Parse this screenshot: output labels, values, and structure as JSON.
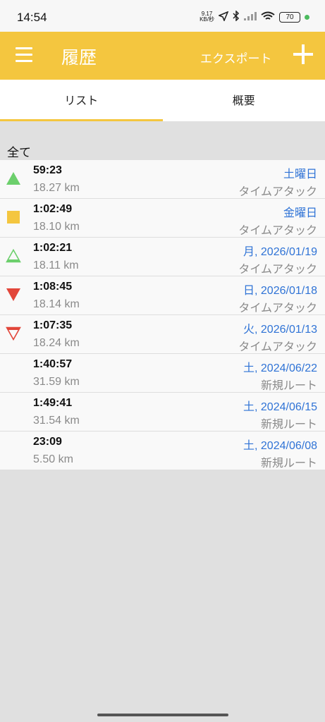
{
  "status_bar": {
    "time": "14:54",
    "speed_value": "9.17",
    "speed_unit": "KB/秒",
    "battery": "70"
  },
  "app_bar": {
    "title": "履歴",
    "export_label": "エクスポート"
  },
  "tabs": [
    {
      "label": "リスト",
      "active": true
    },
    {
      "label": "概要",
      "active": false
    }
  ],
  "section_header": "全て",
  "rows": [
    {
      "icon": "up-triangle-filled-green",
      "time": "59:23",
      "distance": "18.27 km",
      "date": "土曜日",
      "type": "タイムアタック"
    },
    {
      "icon": "square-yellow",
      "time": "1:02:49",
      "distance": "18.10 km",
      "date": "金曜日",
      "type": "タイムアタック"
    },
    {
      "icon": "up-triangle-outline-green",
      "time": "1:02:21",
      "distance": "18.11 km",
      "date": "月, 2026/01/19",
      "type": "タイムアタック"
    },
    {
      "icon": "down-triangle-filled-red",
      "time": "1:08:45",
      "distance": "18.14 km",
      "date": "日, 2026/01/18",
      "type": "タイムアタック"
    },
    {
      "icon": "down-triangle-outline-red",
      "time": "1:07:35",
      "distance": "18.24 km",
      "date": "火, 2026/01/13",
      "type": "タイムアタック"
    },
    {
      "icon": "",
      "time": "1:40:57",
      "distance": "31.59 km",
      "date": "土, 2024/06/22",
      "type": "新規ルート"
    },
    {
      "icon": "",
      "time": "1:49:41",
      "distance": "31.54 km",
      "date": "土, 2024/06/15",
      "type": "新規ルート"
    },
    {
      "icon": "",
      "time": "23:09",
      "distance": "5.50 km",
      "date": "土, 2024/06/08",
      "type": "新規ルート"
    }
  ],
  "colors": {
    "accent": "#f4c63f",
    "date_blue": "#2f73d6",
    "up_green": "#6ccf6c",
    "down_red": "#e2463a",
    "square_yellow": "#f4c63f"
  }
}
